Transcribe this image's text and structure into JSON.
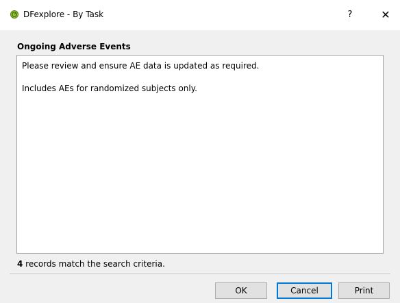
{
  "window": {
    "title": "DFexplore - By Task",
    "help_label": "?",
    "close_label": "✕"
  },
  "heading": "Ongoing Adverse Events",
  "description": {
    "line1": "Please review and ensure AE data is updated as required.",
    "line2": "Includes AEs for randomized subjects only."
  },
  "status": {
    "count": "4",
    "text": " records match the search criteria."
  },
  "buttons": {
    "ok": "OK",
    "cancel": "Cancel",
    "print": "Print"
  },
  "colors": {
    "app_icon": "#9acd32",
    "focus_border": "#0078d7"
  }
}
